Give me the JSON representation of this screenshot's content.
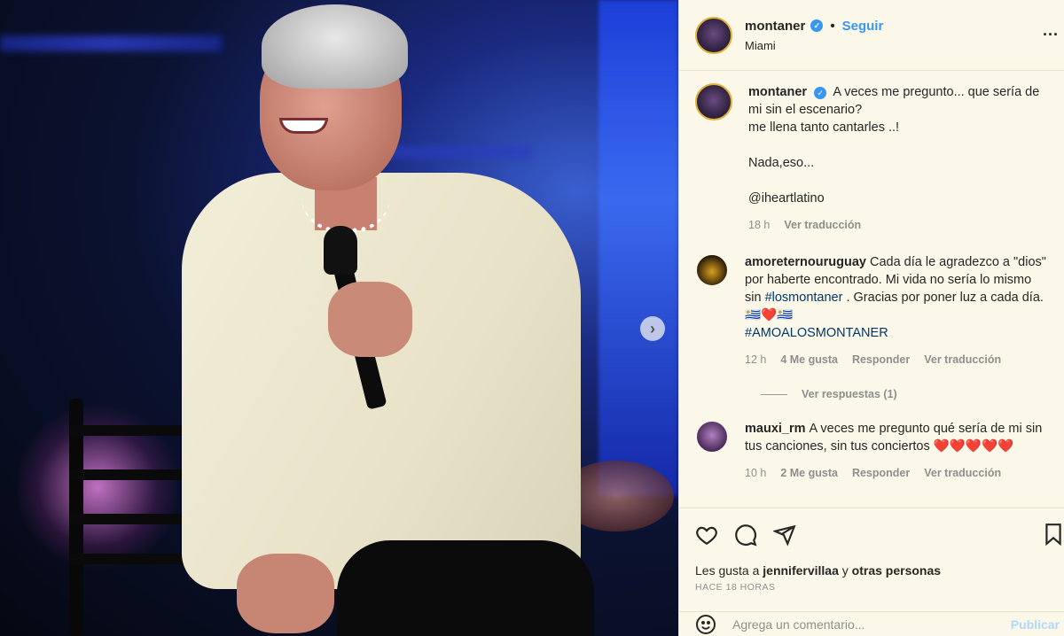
{
  "post": {
    "username": "montaner",
    "follow_label": "Seguir",
    "separator": "•",
    "location": "Miami",
    "more_label": "...",
    "caption_line1": "A veces me pregunto... que sería de mi sin el escenario?",
    "caption_line2": "me llena tanto cantarles ..!",
    "caption_line3": "Nada,eso...",
    "caption_mention": "@iheartlatino",
    "caption_time": "18 h",
    "translate_label": "Ver traducción"
  },
  "comments": [
    {
      "username": "amoreternouruguay",
      "text": "Cada día le agradezco a \"dios\" por haberte encontrado. Mi vida no sería lo mismo sin ",
      "hashtag1": "#losmontaner",
      "text2": " . Gracias por poner luz a cada día.🇺🇾❤️🇺🇾",
      "hashtag2": "#AMOALOSMONTANER",
      "time": "12 h",
      "likes": "4 Me gusta",
      "reply_label": "Responder",
      "translate_label": "Ver traducción",
      "view_replies": "Ver respuestas (1)"
    },
    {
      "username": "mauxi_rm",
      "text": "A veces me pregunto qué sería de mi sin tus canciones, sin tus conciertos ",
      "hearts": "❤️❤️❤️❤️❤️",
      "time": "10 h",
      "likes": "2 Me gusta",
      "reply_label": "Responder",
      "translate_label": "Ver traducción"
    }
  ],
  "footer": {
    "likes_prefix": "Les gusta a",
    "likes_user": "jennifervillaa",
    "likes_and": "y",
    "likes_others": "otras personas",
    "posted_time": "HACE 18 HORAS",
    "comment_placeholder": "Agrega un comentario...",
    "publish_label": "Publicar"
  },
  "icons": [
    "heart-icon",
    "comment-icon",
    "share-icon",
    "bookmark-icon",
    "emoji-icon",
    "verified-icon",
    "chevron-right-icon"
  ]
}
